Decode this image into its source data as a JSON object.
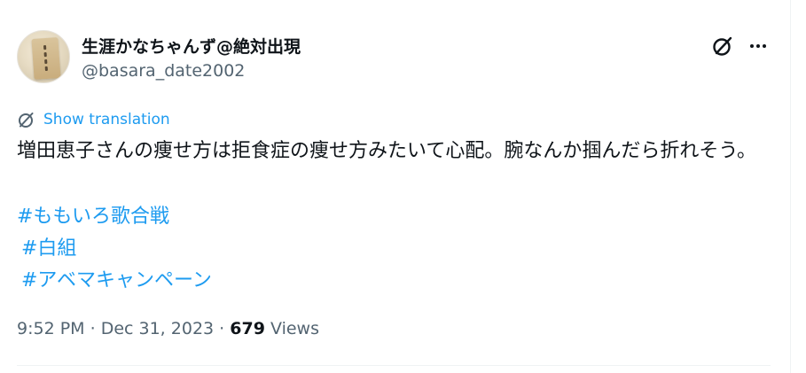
{
  "author": {
    "display_name": "生涯かなちゃんず@絶対出現",
    "handle": "@basara_date2002"
  },
  "icons": {
    "grok": "grok-icon",
    "more": "more-dots-icon",
    "translate": "translate-icon"
  },
  "translation": {
    "label": "Show translation"
  },
  "tweet": {
    "text": "増田恵子さんの痩せ方は拒食症の痩せ方みたいて心配。腕なんか掴んだら折れそう。",
    "hashtags": [
      "#ももいろ歌合戦",
      "#白組",
      "#アベマキャンペーン"
    ]
  },
  "meta": {
    "time": "9:52 PM",
    "separator": "·",
    "date": "Dec 31, 2023",
    "views_count": "679",
    "views_label": "Views"
  },
  "colors": {
    "accent": "#1d9bf0",
    "text_primary": "#0f1419",
    "text_secondary": "#536471"
  }
}
